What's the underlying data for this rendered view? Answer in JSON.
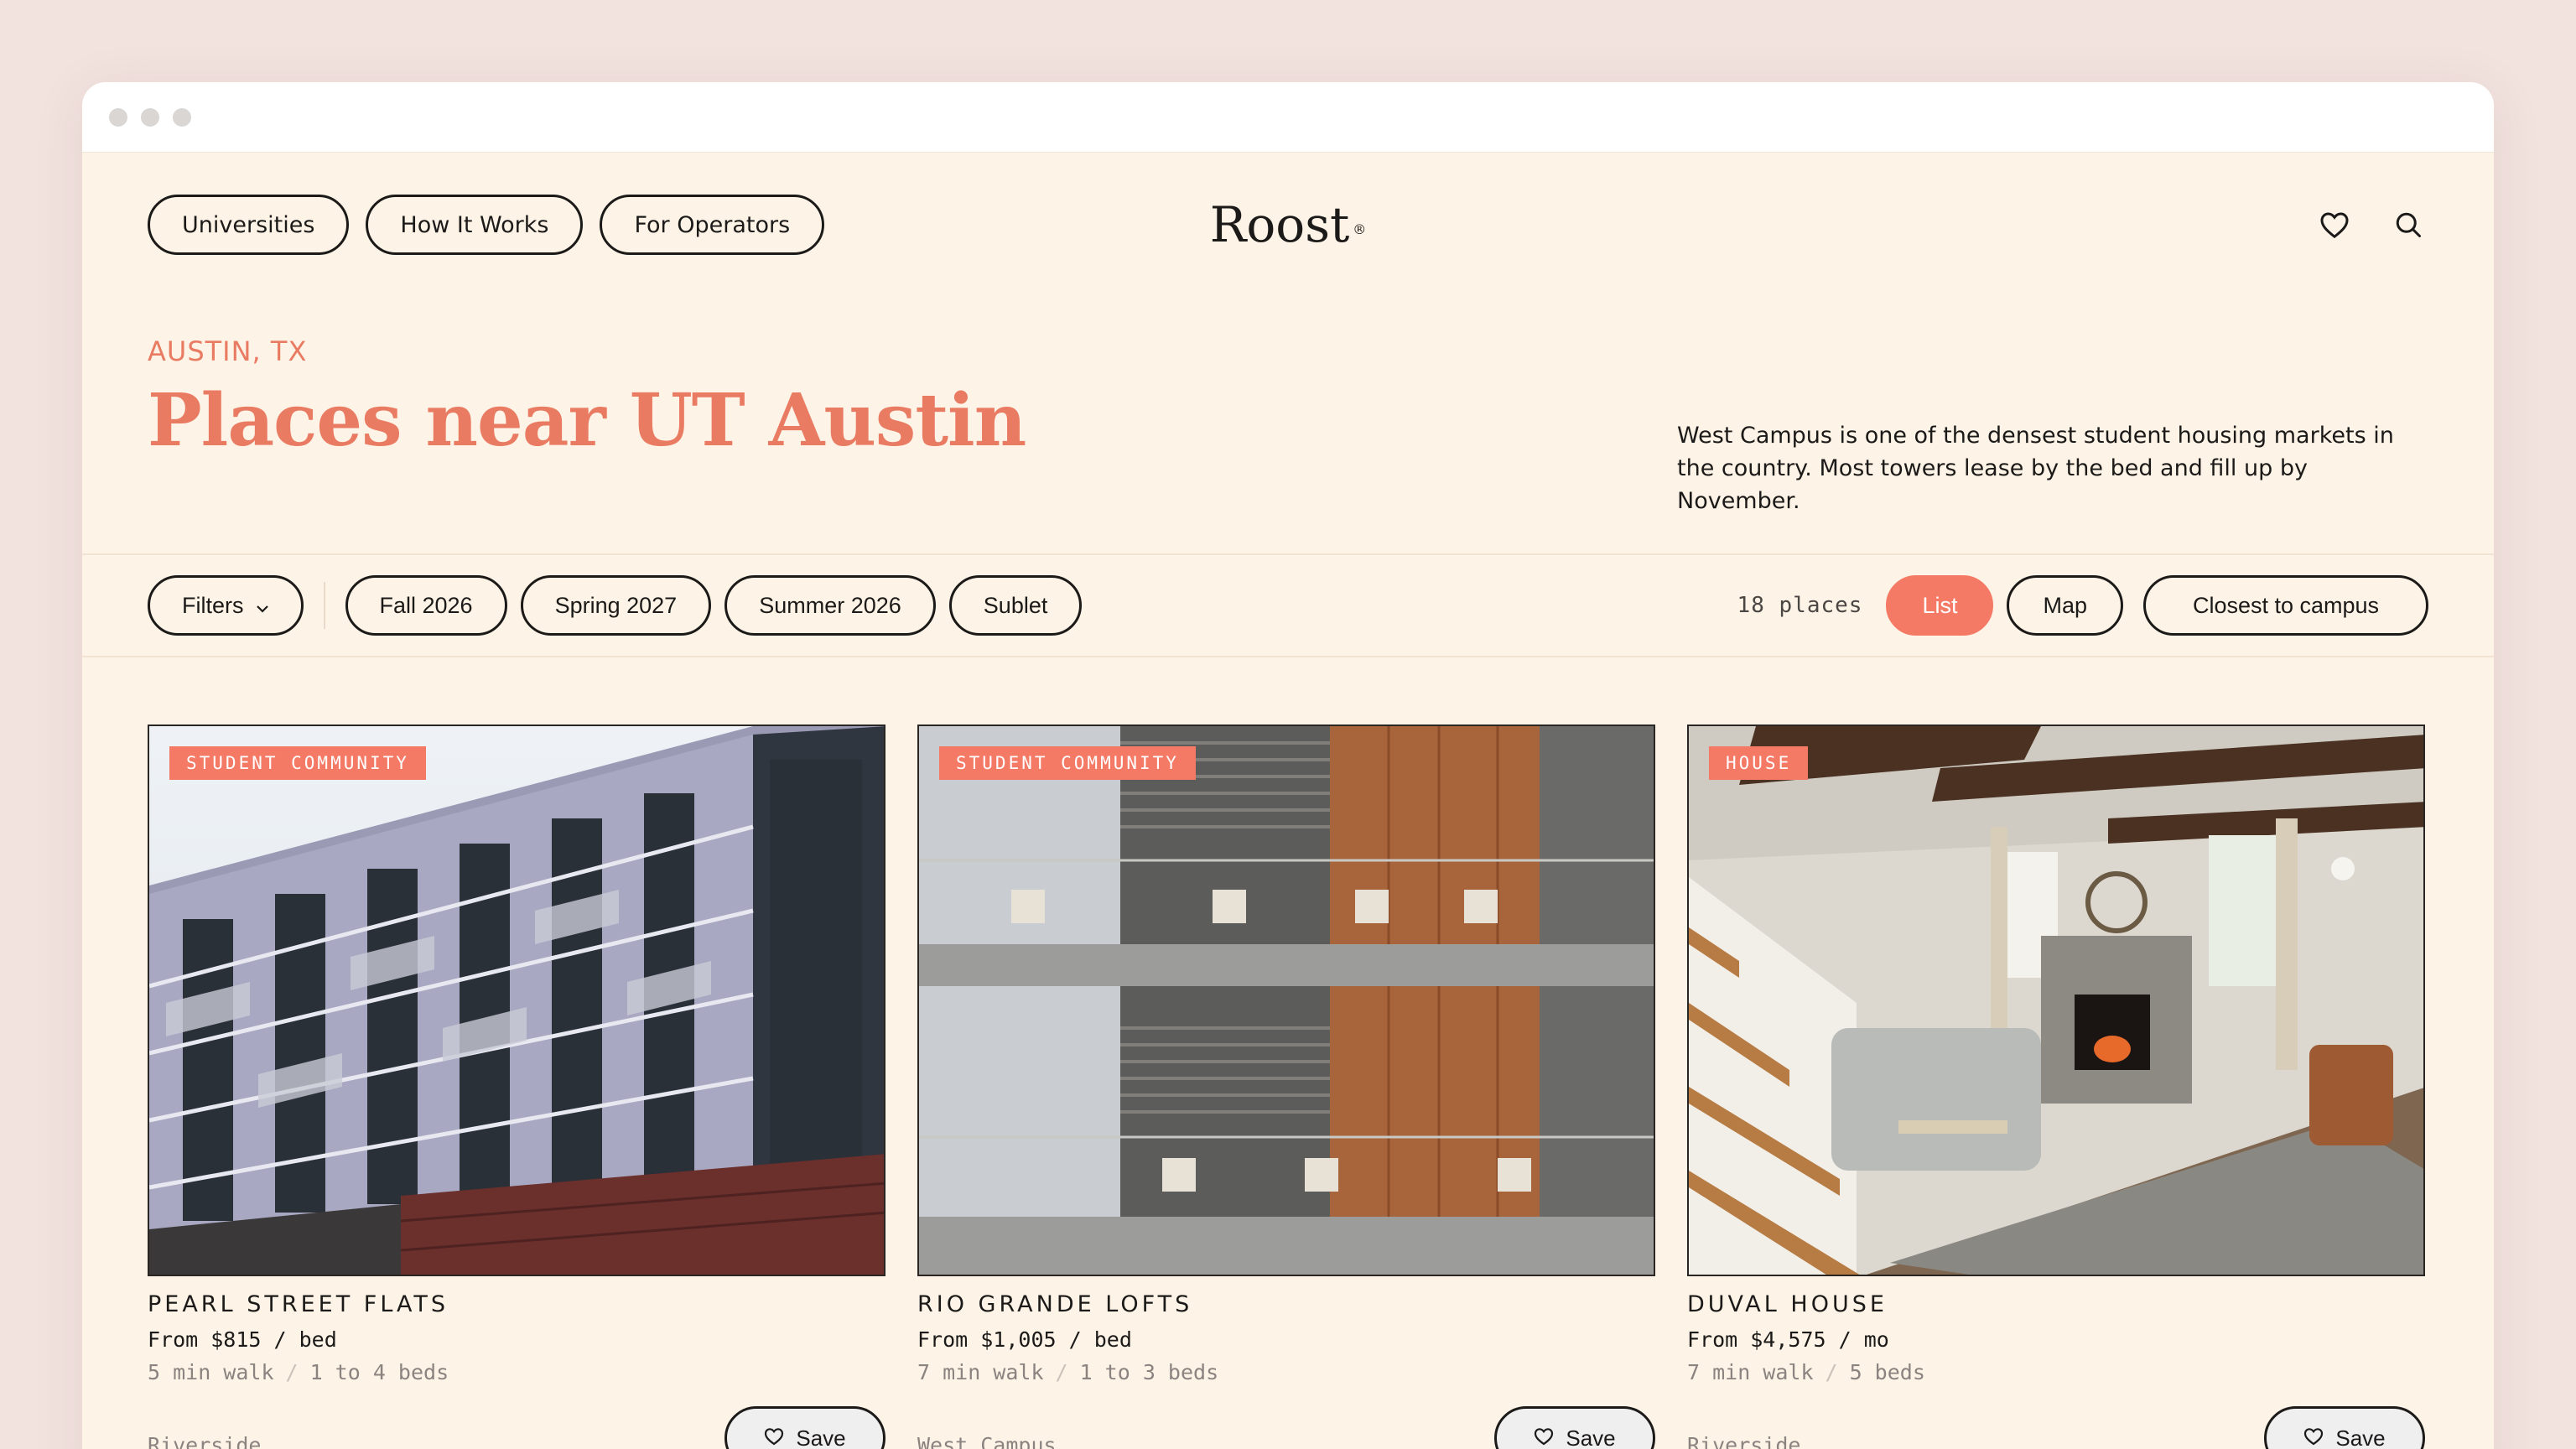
{
  "brand": {
    "logo_text": "Roost",
    "logo_mark": "®"
  },
  "nav": {
    "items": [
      "Universities",
      "How It Works",
      "For Operators"
    ]
  },
  "hero": {
    "eyebrow": "AUSTIN, TX",
    "title": "Places near UT Austin",
    "intro": "West Campus is one of the densest student housing markets in the country. Most towers lease by the bed and fill up by November."
  },
  "filters": {
    "filters_label": "Filters",
    "terms": [
      "Fall 2026",
      "Spring 2027",
      "Summer 2026",
      "Sublet"
    ],
    "count": "18 places",
    "views": [
      "List",
      "Map"
    ],
    "active_view": "List",
    "sort_label": "Closest to campus"
  },
  "icons": {
    "favorites": "heart-icon",
    "search": "search-icon",
    "filters_caret": "chevron-down-icon",
    "save": "heart-icon"
  },
  "colors": {
    "accent": "#f47a66",
    "background": "#fdf3e6",
    "ink": "#1c1a19"
  },
  "listings": [
    {
      "badge": "STUDENT COMMUNITY",
      "name": "PEARL STREET FLATS",
      "price": "From $815 / bed",
      "walk": "5 min walk",
      "beds": "1 to 4 beds",
      "neighborhood": "Riverside",
      "save_label": "Save"
    },
    {
      "badge": "STUDENT COMMUNITY",
      "name": "RIO GRANDE LOFTS",
      "price": "From $1,005 / bed",
      "walk": "7 min walk",
      "beds": "1 to 3 beds",
      "neighborhood": "West Campus",
      "save_label": "Save"
    },
    {
      "badge": "HOUSE",
      "name": "DUVAL HOUSE",
      "price": "From $4,575 / mo",
      "walk": "7 min walk",
      "beds": "5 beds",
      "neighborhood": "Riverside",
      "save_label": "Save"
    }
  ]
}
